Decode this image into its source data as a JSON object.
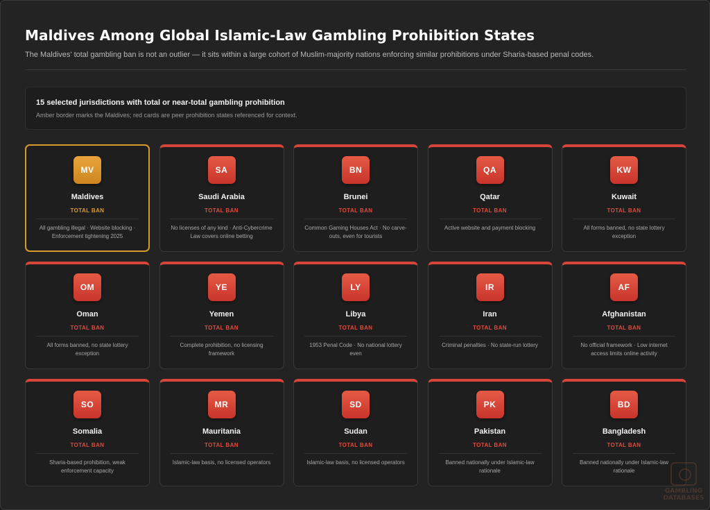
{
  "header": {
    "title": "Maldives Among Global Islamic-Law Gambling Prohibition States",
    "subtitle": "The Maldives' total gambling ban is not an outlier — it sits within a large cohort of Muslim-majority nations enforcing similar prohibitions under Sharia-based penal codes."
  },
  "info": {
    "title": "15 selected jurisdictions with total or near-total gambling prohibition",
    "note": "Amber border marks the Maldives; red cards are peer prohibition states referenced for context."
  },
  "colors": {
    "amber": "#d89a2b",
    "red": "#d6453a",
    "background": "#232323"
  },
  "cards": [
    {
      "code": "MV",
      "name": "Maldives",
      "status": "TOTAL BAN",
      "detail": "All gambling illegal · Website blocking · Enforcement tightening 2025",
      "highlight": true
    },
    {
      "code": "SA",
      "name": "Saudi Arabia",
      "status": "TOTAL BAN",
      "detail": "No licenses of any kind · Anti-Cybercrime Law covers online betting"
    },
    {
      "code": "BN",
      "name": "Brunei",
      "status": "TOTAL BAN",
      "detail": "Common Gaming Houses Act · No carve-outs, even for tourists"
    },
    {
      "code": "QA",
      "name": "Qatar",
      "status": "TOTAL BAN",
      "detail": "Active website and payment blocking"
    },
    {
      "code": "KW",
      "name": "Kuwait",
      "status": "TOTAL BAN",
      "detail": "All forms banned, no state lottery exception"
    },
    {
      "code": "OM",
      "name": "Oman",
      "status": "TOTAL BAN",
      "detail": "All forms banned, no state lottery exception"
    },
    {
      "code": "YE",
      "name": "Yemen",
      "status": "TOTAL BAN",
      "detail": "Complete prohibition, no licensing framework"
    },
    {
      "code": "LY",
      "name": "Libya",
      "status": "TOTAL BAN",
      "detail": "1953 Penal Code · No national lottery even"
    },
    {
      "code": "IR",
      "name": "Iran",
      "status": "TOTAL BAN",
      "detail": "Criminal penalties · No state-run lottery"
    },
    {
      "code": "AF",
      "name": "Afghanistan",
      "status": "TOTAL BAN",
      "detail": "No official framework · Low internet access limits online activity"
    },
    {
      "code": "SO",
      "name": "Somalia",
      "status": "TOTAL BAN",
      "detail": "Sharia-based prohibition, weak enforcement capacity"
    },
    {
      "code": "MR",
      "name": "Mauritania",
      "status": "TOTAL BAN",
      "detail": "Islamic-law basis, no licensed operators"
    },
    {
      "code": "SD",
      "name": "Sudan",
      "status": "TOTAL BAN",
      "detail": "Islamic-law basis, no licensed operators"
    },
    {
      "code": "PK",
      "name": "Pakistan",
      "status": "TOTAL BAN",
      "detail": "Banned nationally under Islamic-law rationale"
    },
    {
      "code": "BD",
      "name": "Bangladesh",
      "status": "TOTAL BAN",
      "detail": "Banned nationally under Islamic-law rationale"
    }
  ],
  "watermark": {
    "line1": "GAMBLING",
    "line2": "DATABASES"
  }
}
